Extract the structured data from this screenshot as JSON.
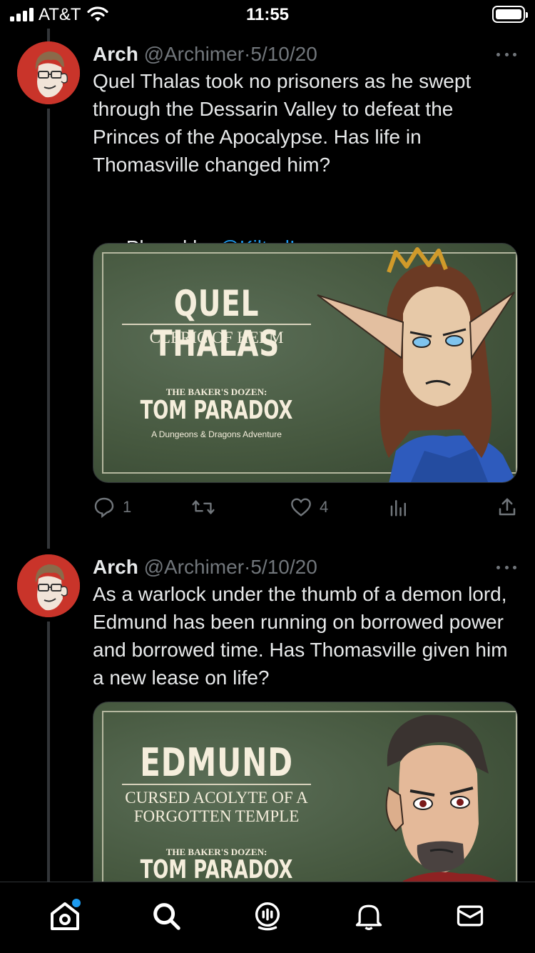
{
  "status_bar": {
    "carrier": "AT&T",
    "time": "11:55",
    "battery_level": 1.0
  },
  "tweets": [
    {
      "name": "Arch",
      "handle": "@Archimer",
      "separator": "·",
      "date": "5/10/20",
      "text": "Quel Thalas took no prisoners as he swept through the Dessarin Valley to defeat the Princes of the Apocalypse. Has life in Thomasville changed him?",
      "played_by_prefix": "Played by ",
      "played_by_mention": "@KiltedIan",
      "card": {
        "title": "QUEL THALAS",
        "subtitle": "CLERIC OF HELM",
        "series_small": "THE BAKER'S DOZEN:",
        "series_title": "TOM PARADOX",
        "tagline": "A Dungeons & Dragons Adventure"
      },
      "replies": "1",
      "retweets": "",
      "likes": "4"
    },
    {
      "name": "Arch",
      "handle": "@Archimer",
      "separator": "·",
      "date": "5/10/20",
      "text": "As a warlock under the thumb of a demon lord, Edmund has been running on borrowed power and borrowed time. Has Thomasville given him a new lease on life?",
      "card": {
        "title": "EDMUND",
        "subtitle_line1": "CURSED ACOLYTE OF A",
        "subtitle_line2": "FORGOTTEN TEMPLE",
        "series_small": "THE BAKER'S DOZEN:",
        "series_title": "TOM PARADOX"
      }
    }
  ],
  "bottom_nav": {
    "items": [
      "home",
      "search",
      "spaces",
      "notifications",
      "messages"
    ],
    "home_has_badge": true
  },
  "colors": {
    "background": "#000000",
    "text": "#e7e9ea",
    "muted": "#71767b",
    "link": "#1d9bf0"
  }
}
